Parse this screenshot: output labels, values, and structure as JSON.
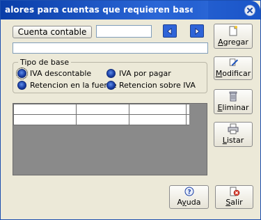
{
  "window": {
    "title": "alores para cuentas que requieren base de rete"
  },
  "toolbar": {
    "cuenta_button_label": "Cuenta contable",
    "cuenta_code_value": "",
    "cuenta_description_value": ""
  },
  "tipo_base": {
    "legend": "Tipo de base",
    "options": [
      {
        "label": "IVA descontable",
        "selected": true
      },
      {
        "label": "IVA por pagar",
        "selected": false
      },
      {
        "label": "Retencion en la fuente",
        "selected": false
      },
      {
        "label": "Retencion sobre IVA",
        "selected": false
      }
    ]
  },
  "grid": {
    "rows": [
      [
        "",
        "",
        "",
        ""
      ],
      [
        "",
        "",
        "",
        ""
      ]
    ]
  },
  "side_buttons": {
    "agregar": {
      "pre": "",
      "key": "A",
      "post": "gregar"
    },
    "modificar": {
      "pre": "",
      "key": "M",
      "post": "odificar"
    },
    "eliminar": {
      "pre": "",
      "key": "E",
      "post": "liminar"
    },
    "listar": {
      "pre": "",
      "key": "L",
      "post": "istar"
    }
  },
  "bottom_buttons": {
    "ayuda": {
      "pre": "A",
      "key": "y",
      "post": "uda"
    },
    "salir": {
      "pre": "",
      "key": "S",
      "post": "alir"
    }
  },
  "icons": {
    "close": "close-icon",
    "prev": "arrow-left-icon",
    "next": "arrow-right-icon",
    "agregar": "new-document-icon",
    "modificar": "edit-pencil-icon",
    "eliminar": "trash-icon",
    "listar": "printer-icon",
    "ayuda": "help-icon",
    "salir": "exit-icon"
  },
  "colors": {
    "titlebar": "#0a3ea8",
    "window_bg": "#ece9d8",
    "radio": "#1b3fa6",
    "grid_bg": "#8a8a8a"
  }
}
